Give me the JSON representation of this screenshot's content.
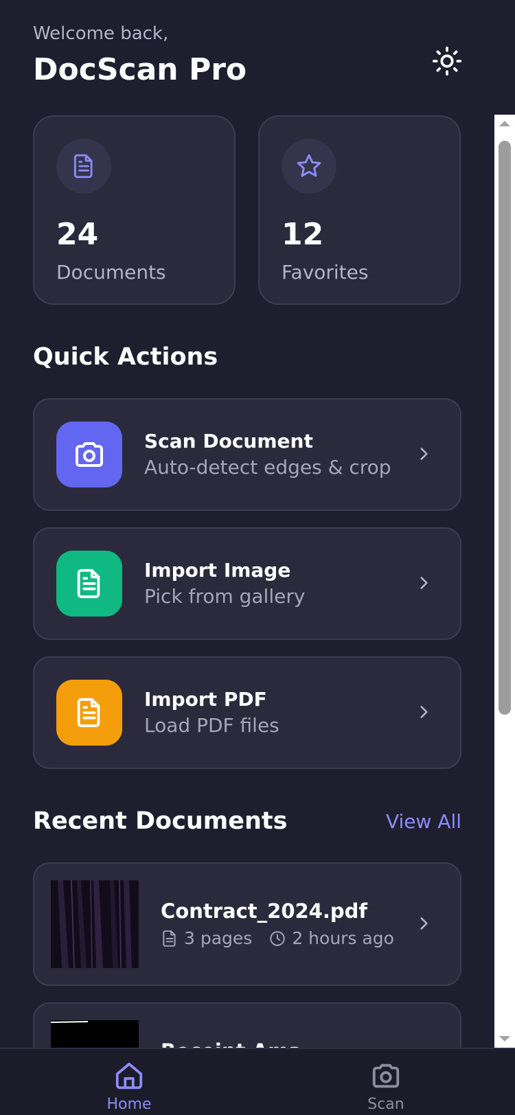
{
  "header": {
    "welcome": "Welcome back,",
    "title": "DocScan Pro",
    "theme_icon": "sun-icon"
  },
  "stats": [
    {
      "value": "24",
      "label": "Documents",
      "icon": "document-icon"
    },
    {
      "value": "12",
      "label": "Favorites",
      "icon": "star-icon"
    }
  ],
  "quick_actions": {
    "title": "Quick Actions",
    "items": [
      {
        "title": "Scan Document",
        "subtitle": "Auto-detect edges & crop",
        "icon": "camera-icon",
        "color": "#6366f1"
      },
      {
        "title": "Import Image",
        "subtitle": "Pick from gallery",
        "icon": "document-icon",
        "color": "#10b981"
      },
      {
        "title": "Import PDF",
        "subtitle": "Load PDF files",
        "icon": "document-icon",
        "color": "#f59e0b"
      }
    ]
  },
  "recent": {
    "title": "Recent Documents",
    "view_all": "View All",
    "items": [
      {
        "name": "Contract_2024.pdf",
        "pages": "3 pages",
        "time": "2 hours ago"
      },
      {
        "name": "Receipt Ama..."
      }
    ]
  },
  "nav": {
    "home": "Home",
    "scan": "Scan"
  },
  "colors": {
    "background": "#1e1e2e",
    "card": "#2a2a3c",
    "accent": "#8b8cf6",
    "text_muted": "#b4b4c8"
  }
}
